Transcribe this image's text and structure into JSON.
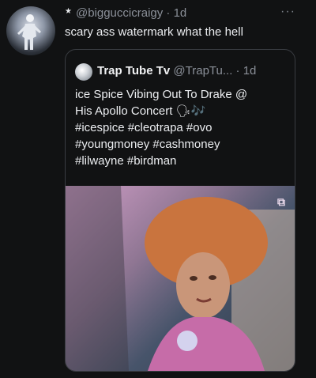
{
  "tweet": {
    "handle": "@bigguccicraigy · 1d",
    "text": "scary ass watermark what the hell",
    "more_icon": "more-dots-icon"
  },
  "quote": {
    "name": "Trap Tube Tv",
    "handle_time": "@TrapTu... · 1d",
    "lines": [
      "ice Spice Vibing Out To Drake @",
      "His Apollo Concert 🗣🎶",
      "#icespice #cleotrapa #ovo",
      "#youngmoney #cashmoney",
      "#lilwayne #birdman"
    ],
    "watermark_icon": "watermark-icon"
  },
  "colors": {
    "background": "#111213",
    "text": "#eceef1",
    "muted": "#8b9099",
    "border": "#3a3d42"
  }
}
